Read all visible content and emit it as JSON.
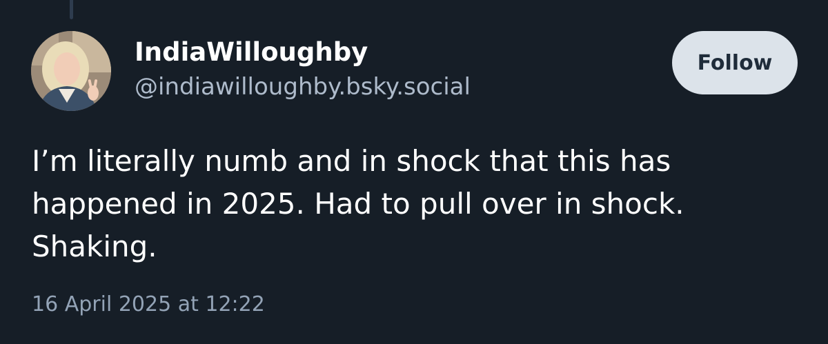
{
  "post": {
    "author": {
      "display_name": "IndiaWilloughby",
      "handle": "@indiawilloughby.bsky.social",
      "avatar_icon": "profile-photo"
    },
    "follow_label": "Follow",
    "text_lines": [
      "I’m literally numb and in shock that this has",
      "happened in 2025. Had to pull over in shock.",
      "Shaking."
    ],
    "timestamp": "16 April 2025 at 12:22"
  },
  "theme": {
    "background": "#161e27",
    "text_primary": "#ffffff",
    "text_secondary": "#aebbcb",
    "button_background": "#dce3ea",
    "button_text": "#1f2c3a"
  }
}
